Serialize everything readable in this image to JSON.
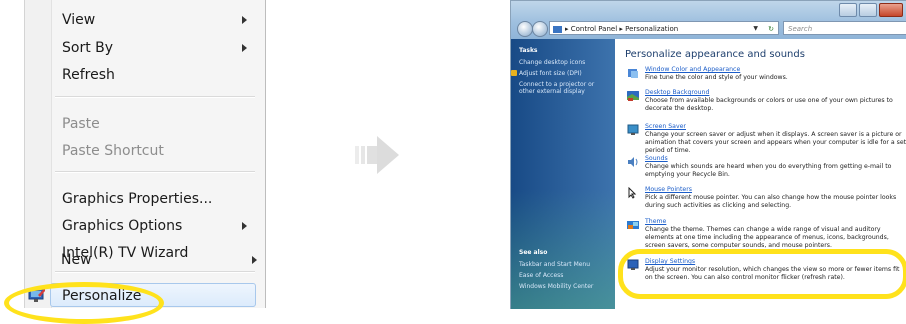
{
  "context_menu": {
    "items": [
      {
        "label": "View",
        "submenu": true,
        "disabled": false
      },
      {
        "label": "Sort By",
        "submenu": true,
        "disabled": false
      },
      {
        "label": "Refresh",
        "submenu": false,
        "disabled": false
      },
      {
        "label": "Paste",
        "submenu": false,
        "disabled": true
      },
      {
        "label": "Paste Shortcut",
        "submenu": false,
        "disabled": true
      },
      {
        "label": "Graphics Properties...",
        "submenu": false,
        "disabled": false
      },
      {
        "label": "Graphics Options",
        "submenu": true,
        "disabled": false
      },
      {
        "label": "Intel(R) TV Wizard",
        "submenu": false,
        "disabled": false
      },
      {
        "label": "New",
        "submenu": true,
        "disabled": false
      },
      {
        "label": "Personalize",
        "submenu": false,
        "disabled": false,
        "highlighted": true
      }
    ]
  },
  "window": {
    "breadcrumb": [
      "Control Panel",
      "Personalization"
    ],
    "search_placeholder": "Search",
    "sidebar": {
      "tasks_heading": "Tasks",
      "tasks": [
        "Change desktop icons",
        "Adjust font size (DPI)",
        "Connect to a projector or other external display"
      ],
      "see_also_heading": "See also",
      "see_also": [
        "Taskbar and Start Menu",
        "Ease of Access",
        "Windows Mobility Center"
      ]
    },
    "title": "Personalize appearance and sounds",
    "items": [
      {
        "link": "Window Color and Appearance",
        "desc": "Fine tune the color and style of your windows."
      },
      {
        "link": "Desktop Background",
        "desc": "Choose from available backgrounds or colors or use one of your own pictures to decorate the desktop."
      },
      {
        "link": "Screen Saver",
        "desc": "Change your screen saver or adjust when it displays. A screen saver is a picture or animation that covers your screen and appears when your computer is idle for a set period of time."
      },
      {
        "link": "Sounds",
        "desc": "Change which sounds are heard when you do everything from getting e-mail to emptying your Recycle Bin."
      },
      {
        "link": "Mouse Pointers",
        "desc": "Pick a different mouse pointer. You can also change how the mouse pointer looks during such activities as clicking and selecting."
      },
      {
        "link": "Theme",
        "desc": "Change the theme. Themes can change a wide range of visual and auditory elements at one time including the appearance of menus, icons, backgrounds, screen savers, some computer sounds, and mouse pointers."
      },
      {
        "link": "Display Settings",
        "desc": "Adjust your monitor resolution, which changes the view so more or fewer items fit on the screen. You can also control monitor flicker (refresh rate)."
      }
    ]
  },
  "colors": {
    "highlight_ring": "#ffe21c",
    "link": "#1a5cc8",
    "sidebar": "#184a86"
  }
}
